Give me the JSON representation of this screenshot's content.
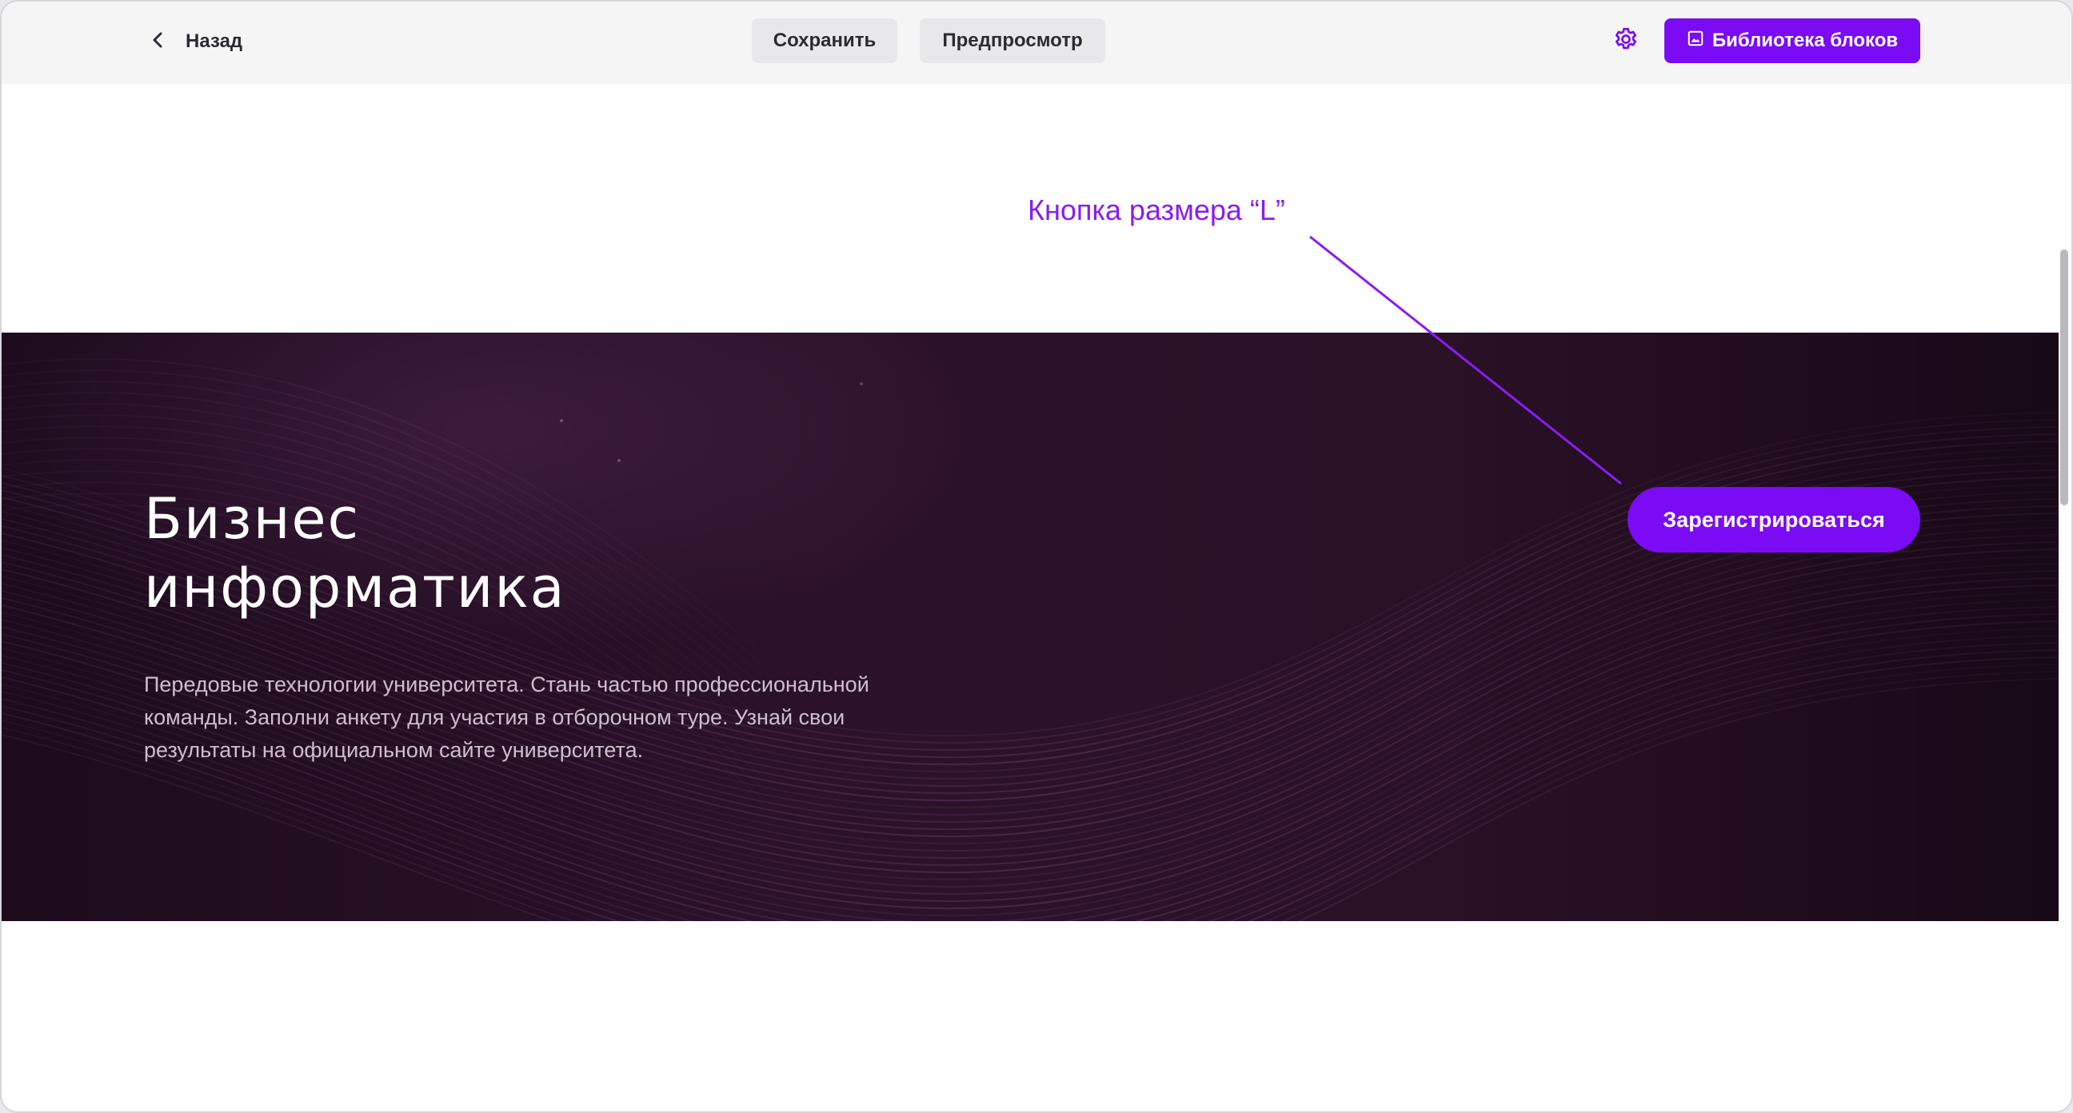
{
  "toolbar": {
    "back_label": "Назад",
    "save_label": "Сохранить",
    "preview_label": "Предпросмотр",
    "library_label": "Библиотека блоков"
  },
  "icons": {
    "back": "chevron-left-icon",
    "settings": "gear-icon",
    "library": "image-icon"
  },
  "annotation": {
    "text": "Кнопка размера “L”"
  },
  "hero": {
    "title_line1": "Бизнес",
    "title_line2": "информатика",
    "description": "Передовые технологии университета. Стань частью профессиональной команды. Заполни анкету для участия в отборочном туре. Узнай свои результаты на официальном сайте университета.",
    "cta_label": "Зарегистрироваться"
  },
  "colors": {
    "accent": "#7b0bf4",
    "annotation": "#8a1cf5",
    "toolbar_bg": "#f5f5f6",
    "hero_bg": "#2a1126"
  }
}
